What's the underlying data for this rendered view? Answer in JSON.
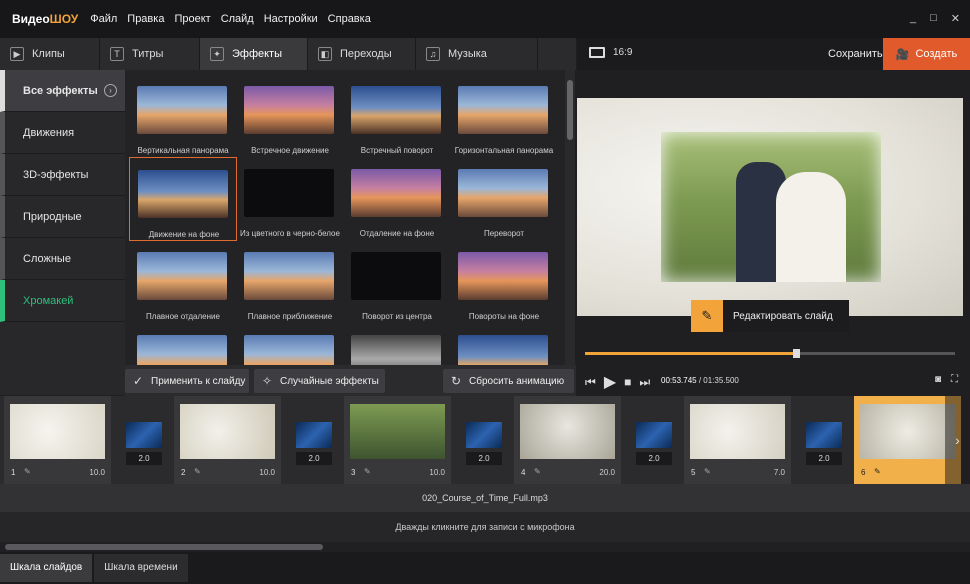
{
  "app": {
    "logo_a": "Видео",
    "logo_b": "ШОУ"
  },
  "menu": [
    "Файл",
    "Правка",
    "Проект",
    "Слайд",
    "Настройки",
    "Справка"
  ],
  "window_controls": {
    "minimize": "_",
    "maximize": "□",
    "close": "✕"
  },
  "tabs": [
    {
      "label": "Клипы",
      "icon": "clips-icon",
      "glyph": "▶"
    },
    {
      "label": "Титры",
      "icon": "titles-icon",
      "glyph": "T"
    },
    {
      "label": "Эффекты",
      "icon": "effects-icon",
      "glyph": "✦",
      "active": true
    },
    {
      "label": "Переходы",
      "icon": "transitions-icon",
      "glyph": "◧"
    },
    {
      "label": "Музыка",
      "icon": "music-icon",
      "glyph": "♫"
    }
  ],
  "categories": [
    {
      "label": "Все эффекты",
      "active": true
    },
    {
      "label": "Движения"
    },
    {
      "label": "3D-эффекты"
    },
    {
      "label": "Природные"
    },
    {
      "label": "Сложные"
    },
    {
      "label": "Хромакей",
      "green": true
    }
  ],
  "effects": [
    {
      "label": "Вертикальная панорама",
      "style": "sky"
    },
    {
      "label": "Встречное движение",
      "style": "sky2"
    },
    {
      "label": "Встречный поворот",
      "style": "sky3"
    },
    {
      "label": "Горизонтальная панорама",
      "style": "sky"
    },
    {
      "label": "Движение на фоне",
      "style": "sky3",
      "selected": true
    },
    {
      "label": "Из цветного в черно-белое",
      "style": "dark"
    },
    {
      "label": "Отдаление на фоне",
      "style": "sky2"
    },
    {
      "label": "Переворот",
      "style": "sky"
    },
    {
      "label": "Плавное отдаление",
      "style": "sky"
    },
    {
      "label": "Плавное приближение",
      "style": "sky"
    },
    {
      "label": "Поворот из центра",
      "style": "dark"
    },
    {
      "label": "Повороты на фоне",
      "style": "sky2"
    },
    {
      "label": "",
      "style": "sky"
    },
    {
      "label": "",
      "style": "sky"
    },
    {
      "label": "",
      "style": "gray"
    },
    {
      "label": "",
      "style": "sky3"
    }
  ],
  "buttons": {
    "apply": "Применить к слайду",
    "random": "Случайные эффекты",
    "reset": "Сбросить анимацию"
  },
  "preview": {
    "ratio": "16:9",
    "save": "Сохранить",
    "create": "Создать",
    "edit_slide": "Редактировать слайд",
    "current_time": "00:53.745",
    "total_time": "01:35.500",
    "progress_percent": 57
  },
  "timeline": {
    "slides": [
      {
        "n": "1",
        "d": "10.0"
      },
      {
        "n": "2",
        "d": "10.0"
      },
      {
        "n": "3",
        "d": "10.0"
      },
      {
        "n": "4",
        "d": "20.0"
      },
      {
        "n": "5",
        "d": "7.0"
      },
      {
        "n": "6",
        "d": "",
        "current": true
      }
    ],
    "transitions": [
      "2.0",
      "2.0",
      "2.0",
      "2.0",
      "2.0"
    ]
  },
  "audio": {
    "file": "020_Course_of_Time_Full.mp3",
    "mic_hint": "Дважды кликните для записи с микрофона"
  },
  "bottom_tabs": [
    "Шкала слайдов",
    "Шкала времени"
  ],
  "colors": {
    "accent": "#f2a33a",
    "create": "#e05a2b",
    "green": "#2fbf7a"
  }
}
